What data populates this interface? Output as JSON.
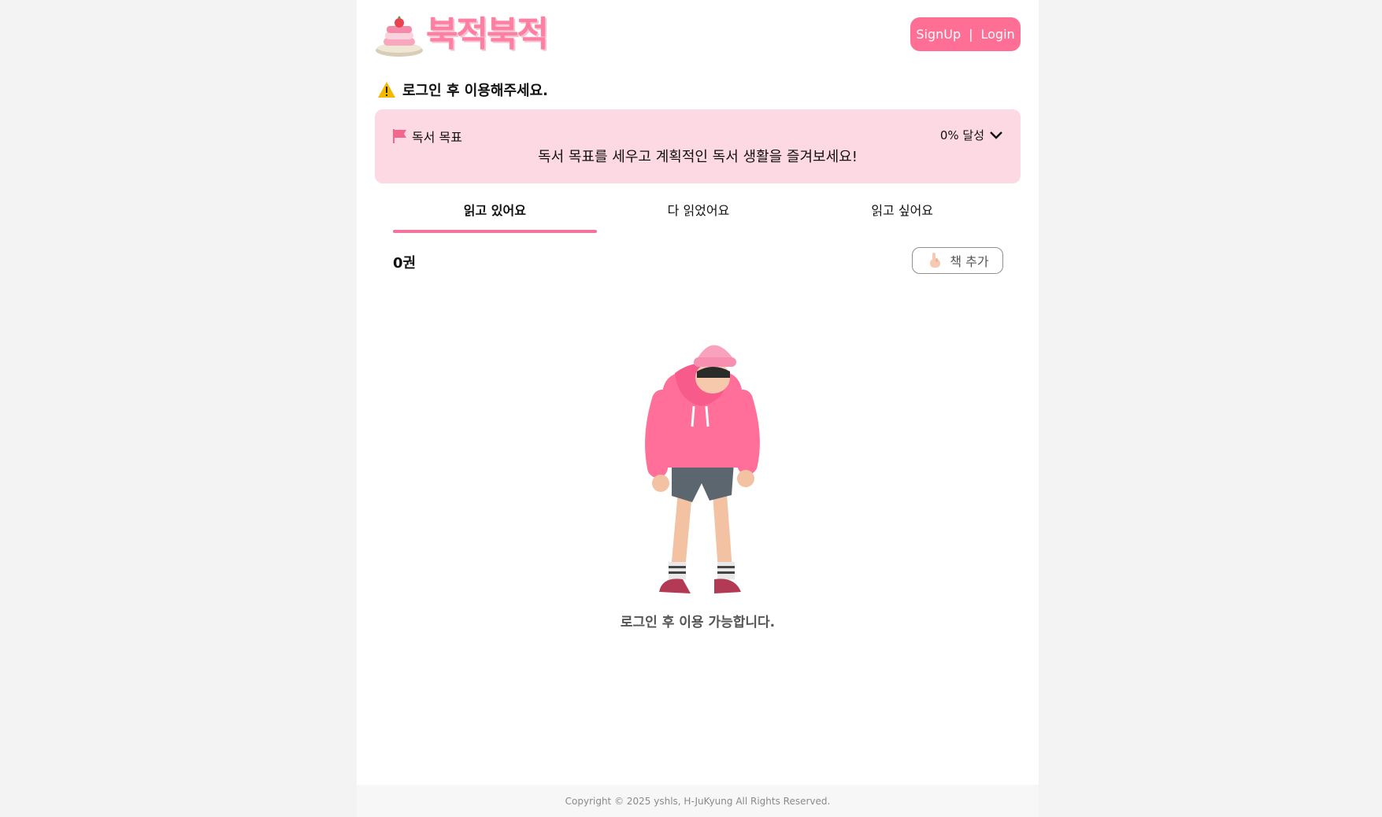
{
  "header": {
    "logo_text": "북적북적",
    "signup_label": "SignUp",
    "separator": "|",
    "login_label": "Login"
  },
  "warning": {
    "icon": "warning-icon",
    "text": "로그인 후 이용해주세요."
  },
  "goal": {
    "icon": "flag-icon",
    "title": "독서 목표",
    "progress_label": "0% 달성",
    "message": "독서 목표를 세우고 계획적인 독서 생활을 즐겨보세요!"
  },
  "tabs": [
    {
      "label": "읽고 있어요",
      "active": true
    },
    {
      "label": "다 읽었어요",
      "active": false
    },
    {
      "label": "읽고 싶어요",
      "active": false
    }
  ],
  "list": {
    "count": "0권",
    "add_label": "책 추가",
    "add_icon": "pointing-hand-icon",
    "empty_message": "로그인 후 이용 가능합니다."
  },
  "footer": {
    "copyright": "Copyright © 2025 yshls, H-JuKyung All Rights Reserved."
  },
  "colors": {
    "accent": "#ff6f95",
    "goal_bg": "#fdd9e3",
    "tab_underline": "#f4739a"
  }
}
